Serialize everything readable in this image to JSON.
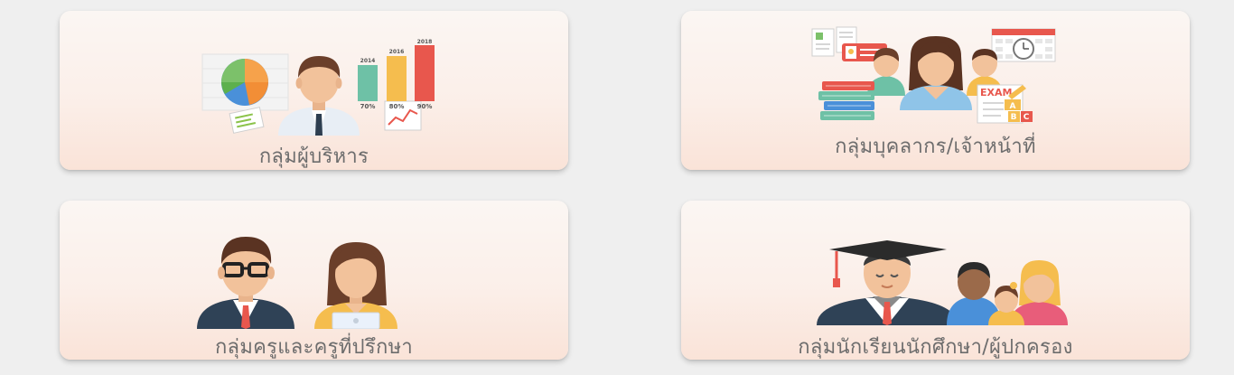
{
  "cards": [
    {
      "label": "กลุ่มผู้บริหาร",
      "icon": "executive-chart-icon",
      "chart_labels": {
        "years": [
          "2014",
          "2016",
          "2018"
        ],
        "percents": [
          "70%",
          "80%",
          "90%"
        ]
      },
      "colors": {
        "bar1": "#6ec1a6",
        "bar2": "#f5bd4e",
        "bar3": "#e8574d"
      }
    },
    {
      "label": "กลุ่มบุคลากร/เจ้าหน้าที่",
      "icon": "staff-group-icon",
      "exam_text": "EXAM",
      "letters": [
        "A",
        "B",
        "C"
      ]
    },
    {
      "label": "กลุ่มครูและครูที่ปรึกษา",
      "icon": "teachers-icon"
    },
    {
      "label": "กลุ่มนักเรียนนักศึกษา/ผู้ปกครอง",
      "icon": "graduate-family-icon"
    }
  ]
}
